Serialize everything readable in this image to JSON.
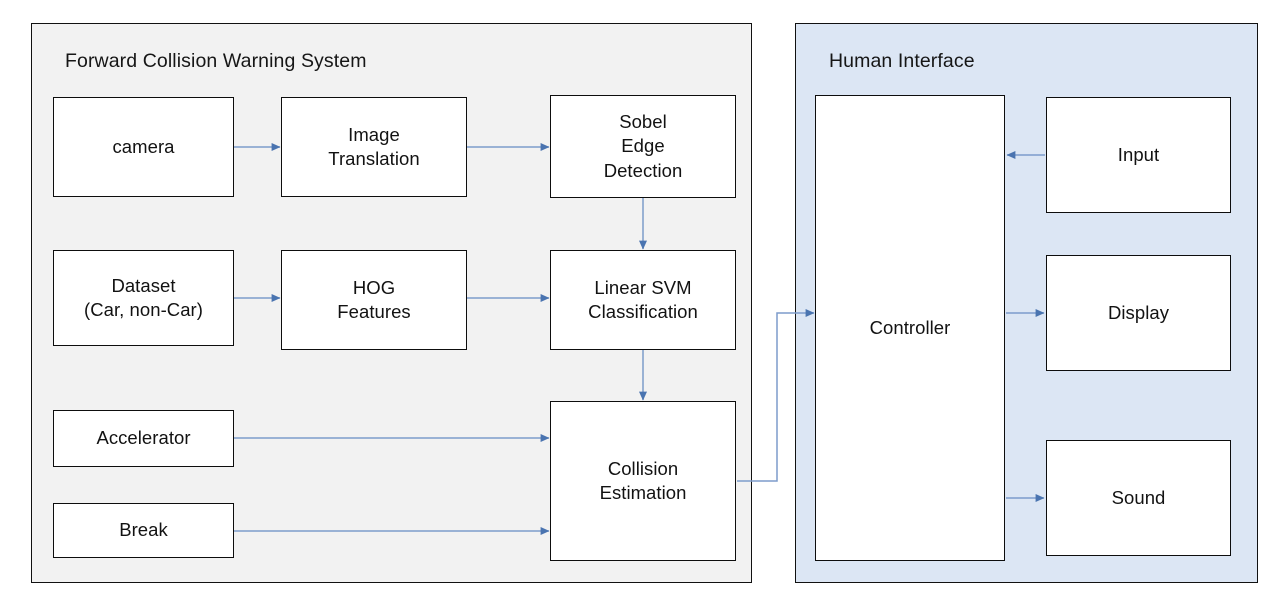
{
  "diagram": {
    "title_visible": false,
    "colors": {
      "left_panel_bg": "#f2f2f2",
      "right_panel_bg": "#dce6f4",
      "node_bg": "#ffffff",
      "node_border": "#0d0d0d",
      "arrow": "#4a74b0",
      "text": "#121212"
    },
    "panels": [
      {
        "id": "fcws",
        "label": "Forward Collision Warning System"
      },
      {
        "id": "human_interface",
        "label": "Human Interface"
      }
    ],
    "nodes": {
      "camera": "camera",
      "image_translation": "Image\nTranslation",
      "sobel_edge_detection": "Sobel\nEdge\nDetection",
      "dataset": "Dataset\n(Car, non-Car)",
      "hog_features": "HOG\nFeatures",
      "linear_svm": "Linear SVM\nClassification",
      "accelerator": "Accelerator",
      "brake": "Break",
      "collision_estimation": "Collision\nEstimation",
      "controller": "Controller",
      "input": "Input",
      "display": "Display",
      "sound": "Sound"
    },
    "edges": [
      {
        "from": "camera",
        "to": "image_translation",
        "direction": "right"
      },
      {
        "from": "image_translation",
        "to": "sobel_edge_detection",
        "direction": "right"
      },
      {
        "from": "sobel_edge_detection",
        "to": "linear_svm",
        "direction": "down"
      },
      {
        "from": "dataset",
        "to": "hog_features",
        "direction": "right"
      },
      {
        "from": "hog_features",
        "to": "linear_svm",
        "direction": "right"
      },
      {
        "from": "linear_svm",
        "to": "collision_estimation",
        "direction": "down"
      },
      {
        "from": "accelerator",
        "to": "collision_estimation",
        "direction": "right"
      },
      {
        "from": "brake",
        "to": "collision_estimation",
        "direction": "right"
      },
      {
        "from": "collision_estimation",
        "to": "controller",
        "direction": "right-up-right"
      },
      {
        "from": "input",
        "to": "controller",
        "direction": "left"
      },
      {
        "from": "controller",
        "to": "display",
        "direction": "right"
      },
      {
        "from": "controller",
        "to": "sound",
        "direction": "right"
      }
    ]
  }
}
